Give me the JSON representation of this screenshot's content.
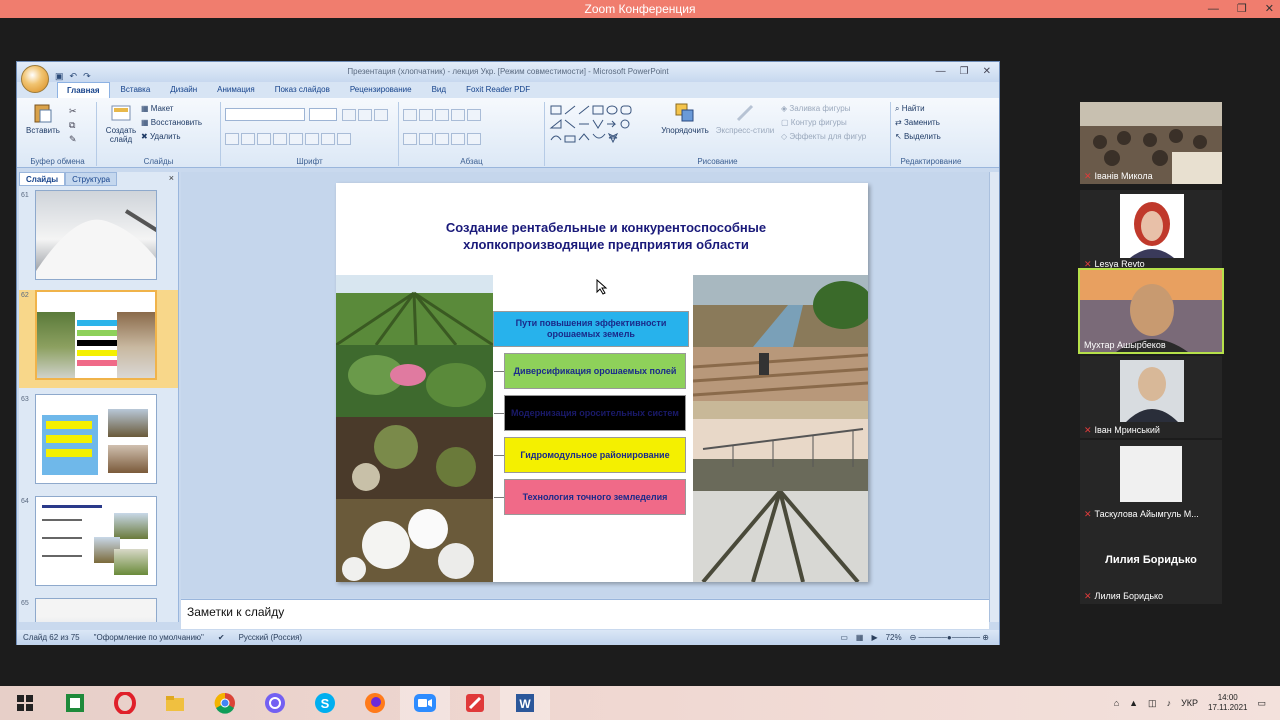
{
  "zoom": {
    "title": "Zoom Конференция",
    "controls": [
      "—",
      "❐",
      "✕"
    ]
  },
  "ppt": {
    "title": "Презентация (хлопчатник) - лекция Укр. [Режим совместимости] - Microsoft PowerPoint",
    "tabs": [
      "Главная",
      "Вставка",
      "Дизайн",
      "Анимация",
      "Показ слайдов",
      "Рецензирование",
      "Вид",
      "Foxit Reader PDF"
    ],
    "ribbon": {
      "clipboard": {
        "paste": "Вставить",
        "label": "Буфер обмена"
      },
      "slides": {
        "create": "Создать слайд",
        "layout": "Макет",
        "reset": "Восстановить",
        "delete": "Удалить",
        "label": "Слайды"
      },
      "font": {
        "label": "Шрифт"
      },
      "paragraph": {
        "label": "Абзац"
      },
      "drawing": {
        "arrange": "Упорядочить",
        "styles": "Экспресс-стили",
        "fill": "Заливка фигуры",
        "outline": "Контур фигуры",
        "effects": "Эффекты для фигур",
        "label": "Рисование"
      },
      "editing": {
        "find": "Найти",
        "replace": "Заменить",
        "select": "Выделить",
        "label": "Редактирование"
      }
    },
    "panel_tabs": [
      "Слайды",
      "Структура"
    ],
    "thumb_numbers": [
      "61",
      "62",
      "63",
      "64",
      "65"
    ],
    "slide": {
      "title_line1": "Создание рентабельные  и конкурентоспособные",
      "title_line2": "хлопкопроизводящие предприятия области",
      "box_header": "Пути повышения  эффективности орошаемых земель",
      "box1": "Диверсификация орошаемых полей",
      "box2": "Модернизация оросительных систем",
      "box3": "Гидромодульное районирование",
      "box4": "Технология точного земледелия"
    },
    "notes": "Заметки к слайду",
    "status": {
      "slide": "Слайд 62 из 75",
      "theme": "\"Оформление по умолчанию\"",
      "lang": "Русский (Россия)",
      "zoom": "72%"
    }
  },
  "participants": [
    {
      "name": "Іванів Микола"
    },
    {
      "name": "Lesya Revto"
    },
    {
      "name": "Мухтар Ашырбеков"
    },
    {
      "name": "Іван Мринський"
    },
    {
      "name": "Таскулова Айымгуль М..."
    },
    {
      "name": "Лилия Боридько",
      "big": "Лилия Боридько"
    }
  ],
  "taskbar": {
    "lang": "УКР",
    "time": "14:00",
    "date": "17.11.2021"
  }
}
